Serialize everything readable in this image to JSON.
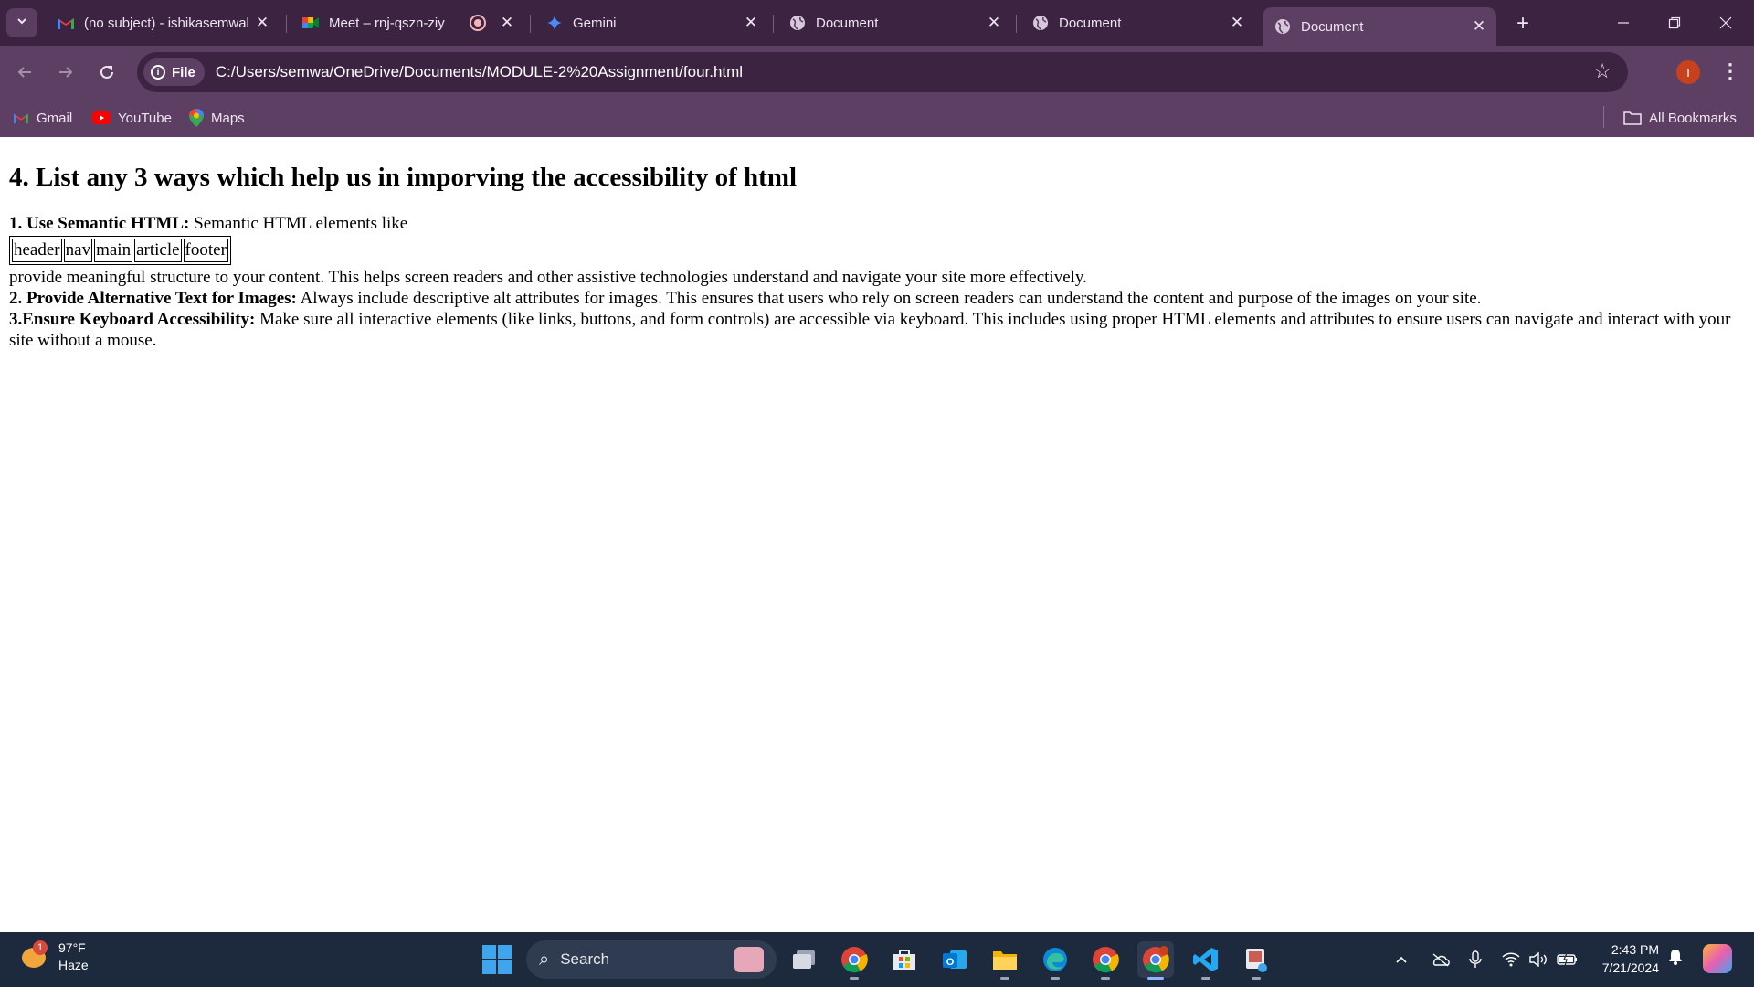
{
  "tabs": [
    {
      "title": "(no subject) - ishikasemwal",
      "icon": "gmail-icon",
      "active": false
    },
    {
      "title": "Meet – rnj-qszn-ziy",
      "icon": "meet-icon",
      "active": false,
      "recording": true
    },
    {
      "title": "Gemini",
      "icon": "gemini-icon",
      "active": false
    },
    {
      "title": "Document",
      "icon": "globe-icon",
      "active": false
    },
    {
      "title": "Document",
      "icon": "globe-icon",
      "active": false
    },
    {
      "title": "Document",
      "icon": "globe-icon",
      "active": true
    }
  ],
  "toolbar": {
    "scheme_chip": "File",
    "url": "C:/Users/semwa/OneDrive/Documents/MODULE-2%20Assignment/four.html",
    "profile_initial": "I"
  },
  "bookmarks": {
    "items": [
      {
        "label": "Gmail",
        "icon": "gmail-icon"
      },
      {
        "label": "YouTube",
        "icon": "youtube-icon"
      },
      {
        "label": "Maps",
        "icon": "maps-icon"
      }
    ],
    "all_label": "All Bookmarks"
  },
  "page": {
    "heading": "4. List any 3 ways which help us in imporving the accessibility of html",
    "point1_label": "1. Use Semantic HTML:",
    "point1_text": " Semantic HTML elements like",
    "semantic_elements": [
      "header",
      "nav",
      "main",
      "article",
      "footer"
    ],
    "point1_after": "provide meaningful structure to your content. This helps screen readers and other assistive technologies understand and navigate your site more effectively.",
    "point2_label": "2. Provide Alternative Text for Images:",
    "point2_text": " Always include descriptive alt attributes for images. This ensures that users who rely on screen readers can understand the content and purpose of the images on your site.",
    "point3_label": "3.Ensure Keyboard Accessibility:",
    "point3_text": " Make sure all interactive elements (like links, buttons, and form controls) are accessible via keyboard. This includes using proper HTML elements and attributes to ensure users can navigate and interact with your site without a mouse."
  },
  "taskbar": {
    "weather_temp": "97°F",
    "weather_desc": "Haze",
    "weather_badge": "1",
    "search_label": "Search",
    "time": "2:43 PM",
    "date": "7/21/2024",
    "apps": [
      "task-view-icon",
      "chrome-icon",
      "store-icon",
      "outlook-icon",
      "file-explorer-icon",
      "edge-icon",
      "chrome-dev-icon",
      "chrome-active-icon",
      "vscode-icon",
      "snipping-tool-icon"
    ]
  },
  "colors": {
    "tabstrip": "#3c2342",
    "toolbar": "#5d3f64",
    "taskbar": "#1d2a3e",
    "profile": "#c8411d"
  }
}
